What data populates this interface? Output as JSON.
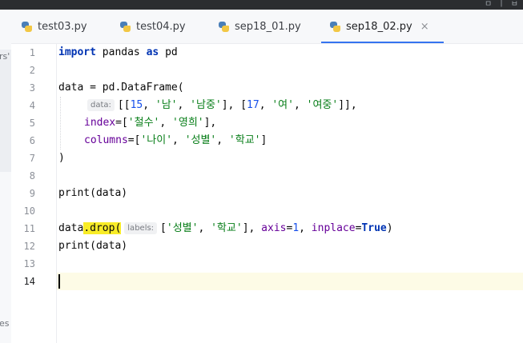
{
  "topbar": {
    "fragment": "ㅁ ㅣ ㅂ"
  },
  "leftstrip": {
    "fragment_top": "rs'",
    "fragment_bottom": "es"
  },
  "tabs": [
    {
      "label": "test03.py"
    },
    {
      "label": "test04.py"
    },
    {
      "label": "sep18_01.py"
    },
    {
      "label": "sep18_02.py",
      "close": "×"
    }
  ],
  "editor": {
    "line_numbers": [
      "1",
      "2",
      "3",
      "4",
      "5",
      "6",
      "7",
      "8",
      "9",
      "10",
      "11",
      "12",
      "13",
      "14"
    ],
    "lines": {
      "l1": {
        "kw1": "import",
        "mod": " pandas ",
        "kw2": "as",
        "alias": " pd"
      },
      "l3": {
        "text": "data = pd.DataFrame("
      },
      "l4": {
        "hint": "data:",
        "p1": "[[",
        "n1": "15",
        "c1": ", ",
        "s1": "'남'",
        "c2": ", ",
        "s2": "'남중'",
        "p2": "], [",
        "n2": "17",
        "c3": ", ",
        "s3": "'여'",
        "c4": ", ",
        "s4": "'여중'",
        "p3": "]],"
      },
      "l5": {
        "param": "index",
        "eq": "=[",
        "s1": "'철수'",
        "c1": ", ",
        "s2": "'영희'",
        "end": "],"
      },
      "l6": {
        "param": "columns",
        "eq": "=[",
        "s1": "'나이'",
        "c1": ", ",
        "s2": "'성별'",
        "c2": ", ",
        "s3": "'학교'",
        "end": "]"
      },
      "l7": {
        "text": ")"
      },
      "l9": {
        "text": "print(data)"
      },
      "l11": {
        "pre": "data",
        "hl": ".drop(",
        "hint": "labels:",
        "b1": "[",
        "s1": "'성별'",
        "c1": ", ",
        "s2": "'학교'",
        "b2": "], ",
        "param1": "axis",
        "eq1": "=",
        "n1": "1",
        "c2": ", ",
        "param2": "inplace",
        "eq2": "=",
        "kw": "True",
        "end": ")"
      },
      "l12": {
        "text": "print(data)"
      }
    }
  }
}
